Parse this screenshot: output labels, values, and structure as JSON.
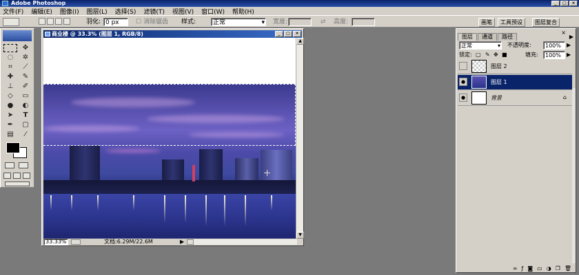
{
  "app": {
    "title": "Adobe Photoshop"
  },
  "menu": [
    "文件(F)",
    "编辑(E)",
    "图像(I)",
    "图层(L)",
    "选择(S)",
    "滤镜(T)",
    "视图(V)",
    "窗口(W)",
    "帮助(H)"
  ],
  "options": {
    "feather_label": "羽化:",
    "feather_value": "0 px",
    "antialias_label": "消除锯齿",
    "style_label": "样式:",
    "style_value": "正常",
    "width_label": "宽度:",
    "height_label": "高度:"
  },
  "palette_well": [
    "画笔",
    "工具预设",
    "图层复合"
  ],
  "document": {
    "title": "商业楼 @ 33.3% (图层 1, RGB/8)",
    "zoom": "33.33%",
    "doc_info": "文档:6.29M/22.6M"
  },
  "layers_panel": {
    "tabs": [
      "图层",
      "通道",
      "路径"
    ],
    "blend_mode": "正常",
    "opacity_label": "不透明度:",
    "opacity": "100%",
    "lock_label": "锁定:",
    "fill_label": "填充:",
    "fill": "100%",
    "layers": [
      {
        "name": "图层 2",
        "visible": false,
        "selected": false
      },
      {
        "name": "图层 1",
        "visible": true,
        "selected": true
      },
      {
        "name": "背景",
        "visible": true,
        "selected": false
      }
    ]
  },
  "colors": {
    "selection_blue": "#0a246a",
    "chrome": "#d4d0c8",
    "workspace": "#7a7a7a"
  }
}
